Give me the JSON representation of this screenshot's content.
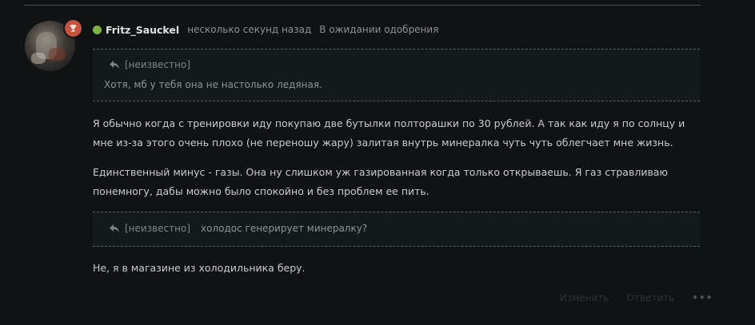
{
  "post": {
    "author": "Fritz_Sauckel",
    "time": "несколько секунд назад",
    "status": "В ожидании одобрения",
    "badge_icon": "trophy-icon",
    "online_color": "#7cb342"
  },
  "quotes": [
    {
      "author": "[неизвестно]",
      "text": "Хотя, мб у тебя она не настолько ледяная."
    },
    {
      "author": "[неизвестно]",
      "text": "холодос генерирует минералку?"
    }
  ],
  "paragraphs": [
    "Я обычно когда с тренировки иду покупаю две бутылки полторашки по 30 рублей. А так как иду я по солнцу и мне из-за этого очень плохо (не переношу жару) залитая внутрь минералка чуть чуть облегчает мне жизнь.",
    "Единственный минус - газы. Она ну слишком уж газированная когда только открываешь. Я газ стравливаю понемногу, дабы можно было спокойно и без проблем ее пить.",
    "Не, я в магазине из холодильника беру."
  ],
  "footer": {
    "link1": "Изменить",
    "link2": "Ответить",
    "more": "•••"
  }
}
